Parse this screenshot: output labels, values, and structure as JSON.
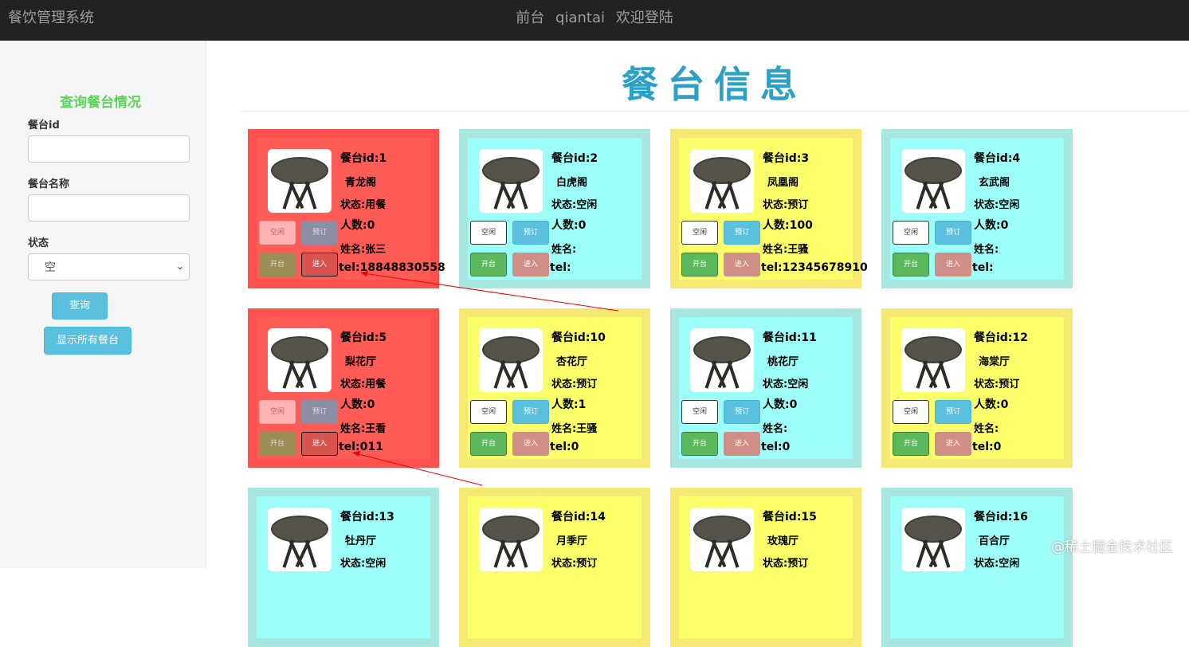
{
  "navbar": {
    "brand": "餐饮管理系统",
    "role": "前台",
    "username": "qiantai",
    "greeting": "欢迎登陆"
  },
  "sidebar": {
    "title": "查询餐台情况",
    "id_label": "餐台id",
    "id_value": "",
    "name_label": "餐台名称",
    "name_value": "",
    "status_label": "状态",
    "status_selected": "空",
    "query_button": "查询",
    "show_all_button": "显示所有餐台"
  },
  "main": {
    "title": "餐台信息"
  },
  "colors": {
    "dining": "#ff524e",
    "dining_inner": "#ff5b57",
    "free": "#a8e6e0",
    "free_inner": "#9cfdf9",
    "booked": "#f5e974",
    "booked_inner": "#fbff6a"
  },
  "buttons": {
    "free": "空闲",
    "book": "预订",
    "open": "开台",
    "enter": "进入"
  },
  "tables": [
    {
      "id_text": "餐台id:1",
      "name": "青龙阁",
      "status": "状态:用餐",
      "people": "人数:0",
      "customer": "姓名:张三",
      "tel": "tel:18848830558",
      "state": "dining"
    },
    {
      "id_text": "餐台id:2",
      "name": "白虎阁",
      "status": "状态:空闲",
      "people": "人数:0",
      "customer": "姓名:",
      "tel": "tel:",
      "state": "free"
    },
    {
      "id_text": "餐台id:3",
      "name": "凤凰阁",
      "status": "状态:预订",
      "people": "人数:100",
      "customer": "姓名:王骚",
      "tel": "tel:12345678910",
      "state": "booked"
    },
    {
      "id_text": "餐台id:4",
      "name": "玄武阁",
      "status": "状态:空闲",
      "people": "人数:0",
      "customer": "姓名:",
      "tel": "tel:",
      "state": "free"
    },
    {
      "id_text": "餐台id:5",
      "name": "梨花厅",
      "status": "状态:用餐",
      "people": "人数:0",
      "customer": "姓名:王看",
      "tel": "tel:011",
      "state": "dining"
    },
    {
      "id_text": "餐台id:10",
      "name": "杏花厅",
      "status": "状态:预订",
      "people": "人数:1",
      "customer": "姓名:王骚",
      "tel": "tel:0",
      "state": "booked"
    },
    {
      "id_text": "餐台id:11",
      "name": "桃花厅",
      "status": "状态:空闲",
      "people": "人数:0",
      "customer": "姓名:",
      "tel": "tel:0",
      "state": "free"
    },
    {
      "id_text": "餐台id:12",
      "name": "海棠厅",
      "status": "状态:预订",
      "people": "人数:0",
      "customer": "姓名:",
      "tel": "tel:0",
      "state": "booked"
    },
    {
      "id_text": "餐台id:13",
      "name": "牡丹厅",
      "status": "状态:空闲",
      "state": "free"
    },
    {
      "id_text": "餐台id:14",
      "name": "月季厅",
      "status": "状态:预订",
      "state": "booked"
    },
    {
      "id_text": "餐台id:15",
      "name": "玫瑰厅",
      "status": "状态:预订",
      "state": "booked"
    },
    {
      "id_text": "餐台id:16",
      "name": "百合厅",
      "status": "状态:空闲",
      "state": "free"
    }
  ],
  "watermark": "@稀土掘金技术社区"
}
